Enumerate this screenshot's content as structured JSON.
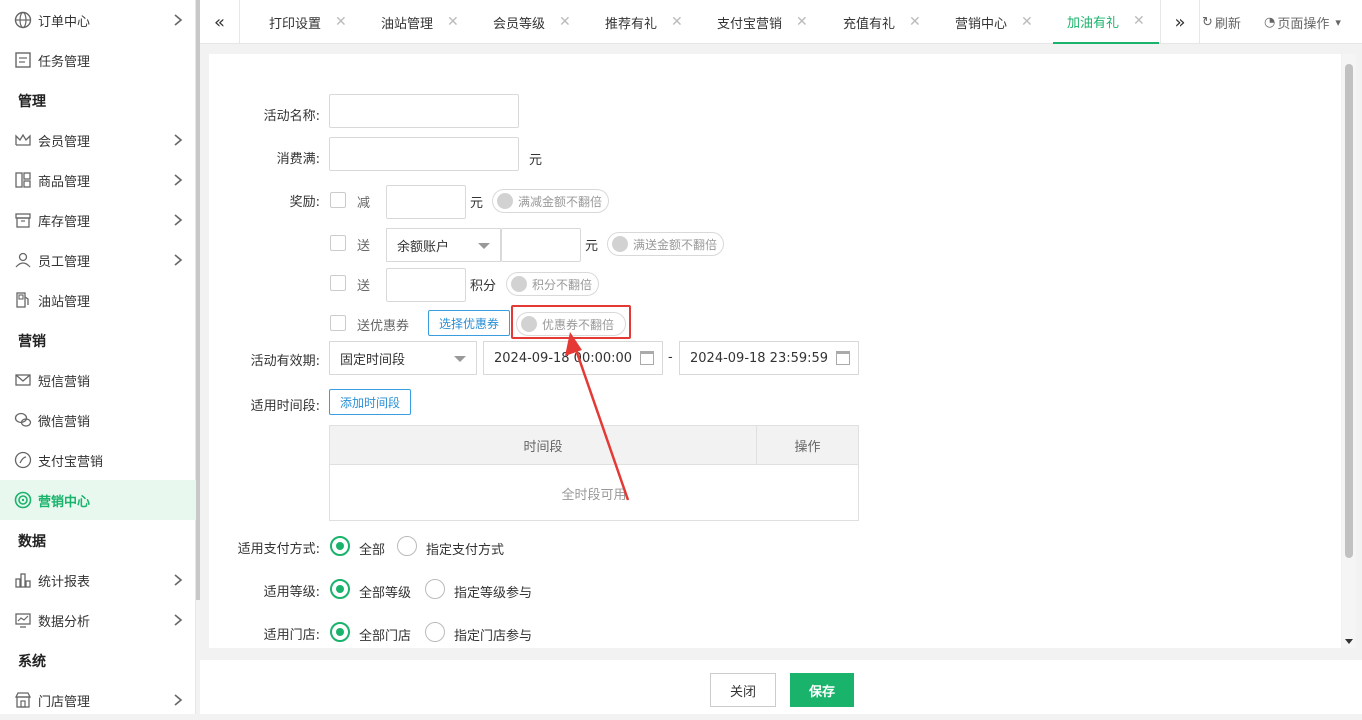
{
  "sidebar": {
    "items": [
      {
        "label": "订单中心",
        "icon": "globe-icon"
      },
      {
        "label": "任务管理",
        "icon": "task-icon"
      },
      {
        "label": "会员管理",
        "icon": "crown-icon"
      },
      {
        "label": "商品管理",
        "icon": "goods-icon"
      },
      {
        "label": "库存管理",
        "icon": "inventory-icon"
      },
      {
        "label": "员工管理",
        "icon": "user-icon"
      },
      {
        "label": "油站管理",
        "icon": "fuel-station-icon"
      },
      {
        "label": "短信营销",
        "icon": "mail-icon"
      },
      {
        "label": "微信营销",
        "icon": "wechat-icon"
      },
      {
        "label": "支付宝营销",
        "icon": "alipay-icon"
      },
      {
        "label": "营销中心",
        "icon": "target-icon"
      },
      {
        "label": "统计报表",
        "icon": "bar-chart-icon"
      },
      {
        "label": "数据分析",
        "icon": "monitor-chart-icon"
      },
      {
        "label": "门店管理",
        "icon": "store-icon"
      }
    ],
    "sections": [
      "管理",
      "营销",
      "数据",
      "系统"
    ]
  },
  "tabs": {
    "items": [
      "打印设置",
      "油站管理",
      "会员等级",
      "推荐有礼",
      "支付宝营销",
      "充值有礼",
      "营销中心",
      "加油有礼"
    ],
    "active": "加油有礼",
    "refresh": "刷新",
    "page_ops": "页面操作"
  },
  "form": {
    "name_label": "活动名称:",
    "min_spend_label": "消费满:",
    "yuan": "元",
    "reward_label": "奖励:",
    "reduce": "减",
    "reduce_toggle": "满减金额不翻倍",
    "give": "送",
    "account_select": "余额账户",
    "give_toggle": "满送金额不翻倍",
    "points": "积分",
    "points_toggle": "积分不翻倍",
    "coupon": "送优惠券",
    "select_coupon_btn": "选择优惠券",
    "coupon_toggle": "优惠券不翻倍",
    "validity_label": "活动有效期:",
    "validity_select": "固定时间段",
    "start_date": "2024-09-18 00:00:00",
    "dash": "-",
    "end_date": "2024-09-18 23:59:59",
    "period_label": "适用时间段:",
    "add_period_btn": "添加时间段",
    "table_col_period": "时间段",
    "table_col_ops": "操作",
    "table_empty": "全时段可用",
    "payment_label": "适用支付方式:",
    "payment_all": "全部",
    "payment_specific": "指定支付方式",
    "level_label": "适用等级:",
    "level_all": "全部等级",
    "level_specific": "指定等级参与",
    "store_label": "适用门店:",
    "store_all": "全部门店",
    "store_specific": "指定门店参与"
  },
  "footer": {
    "close": "关闭",
    "save": "保存"
  },
  "colors": {
    "accent": "#1ab36b",
    "link": "#2a8fd6",
    "annotation": "#e53935"
  }
}
